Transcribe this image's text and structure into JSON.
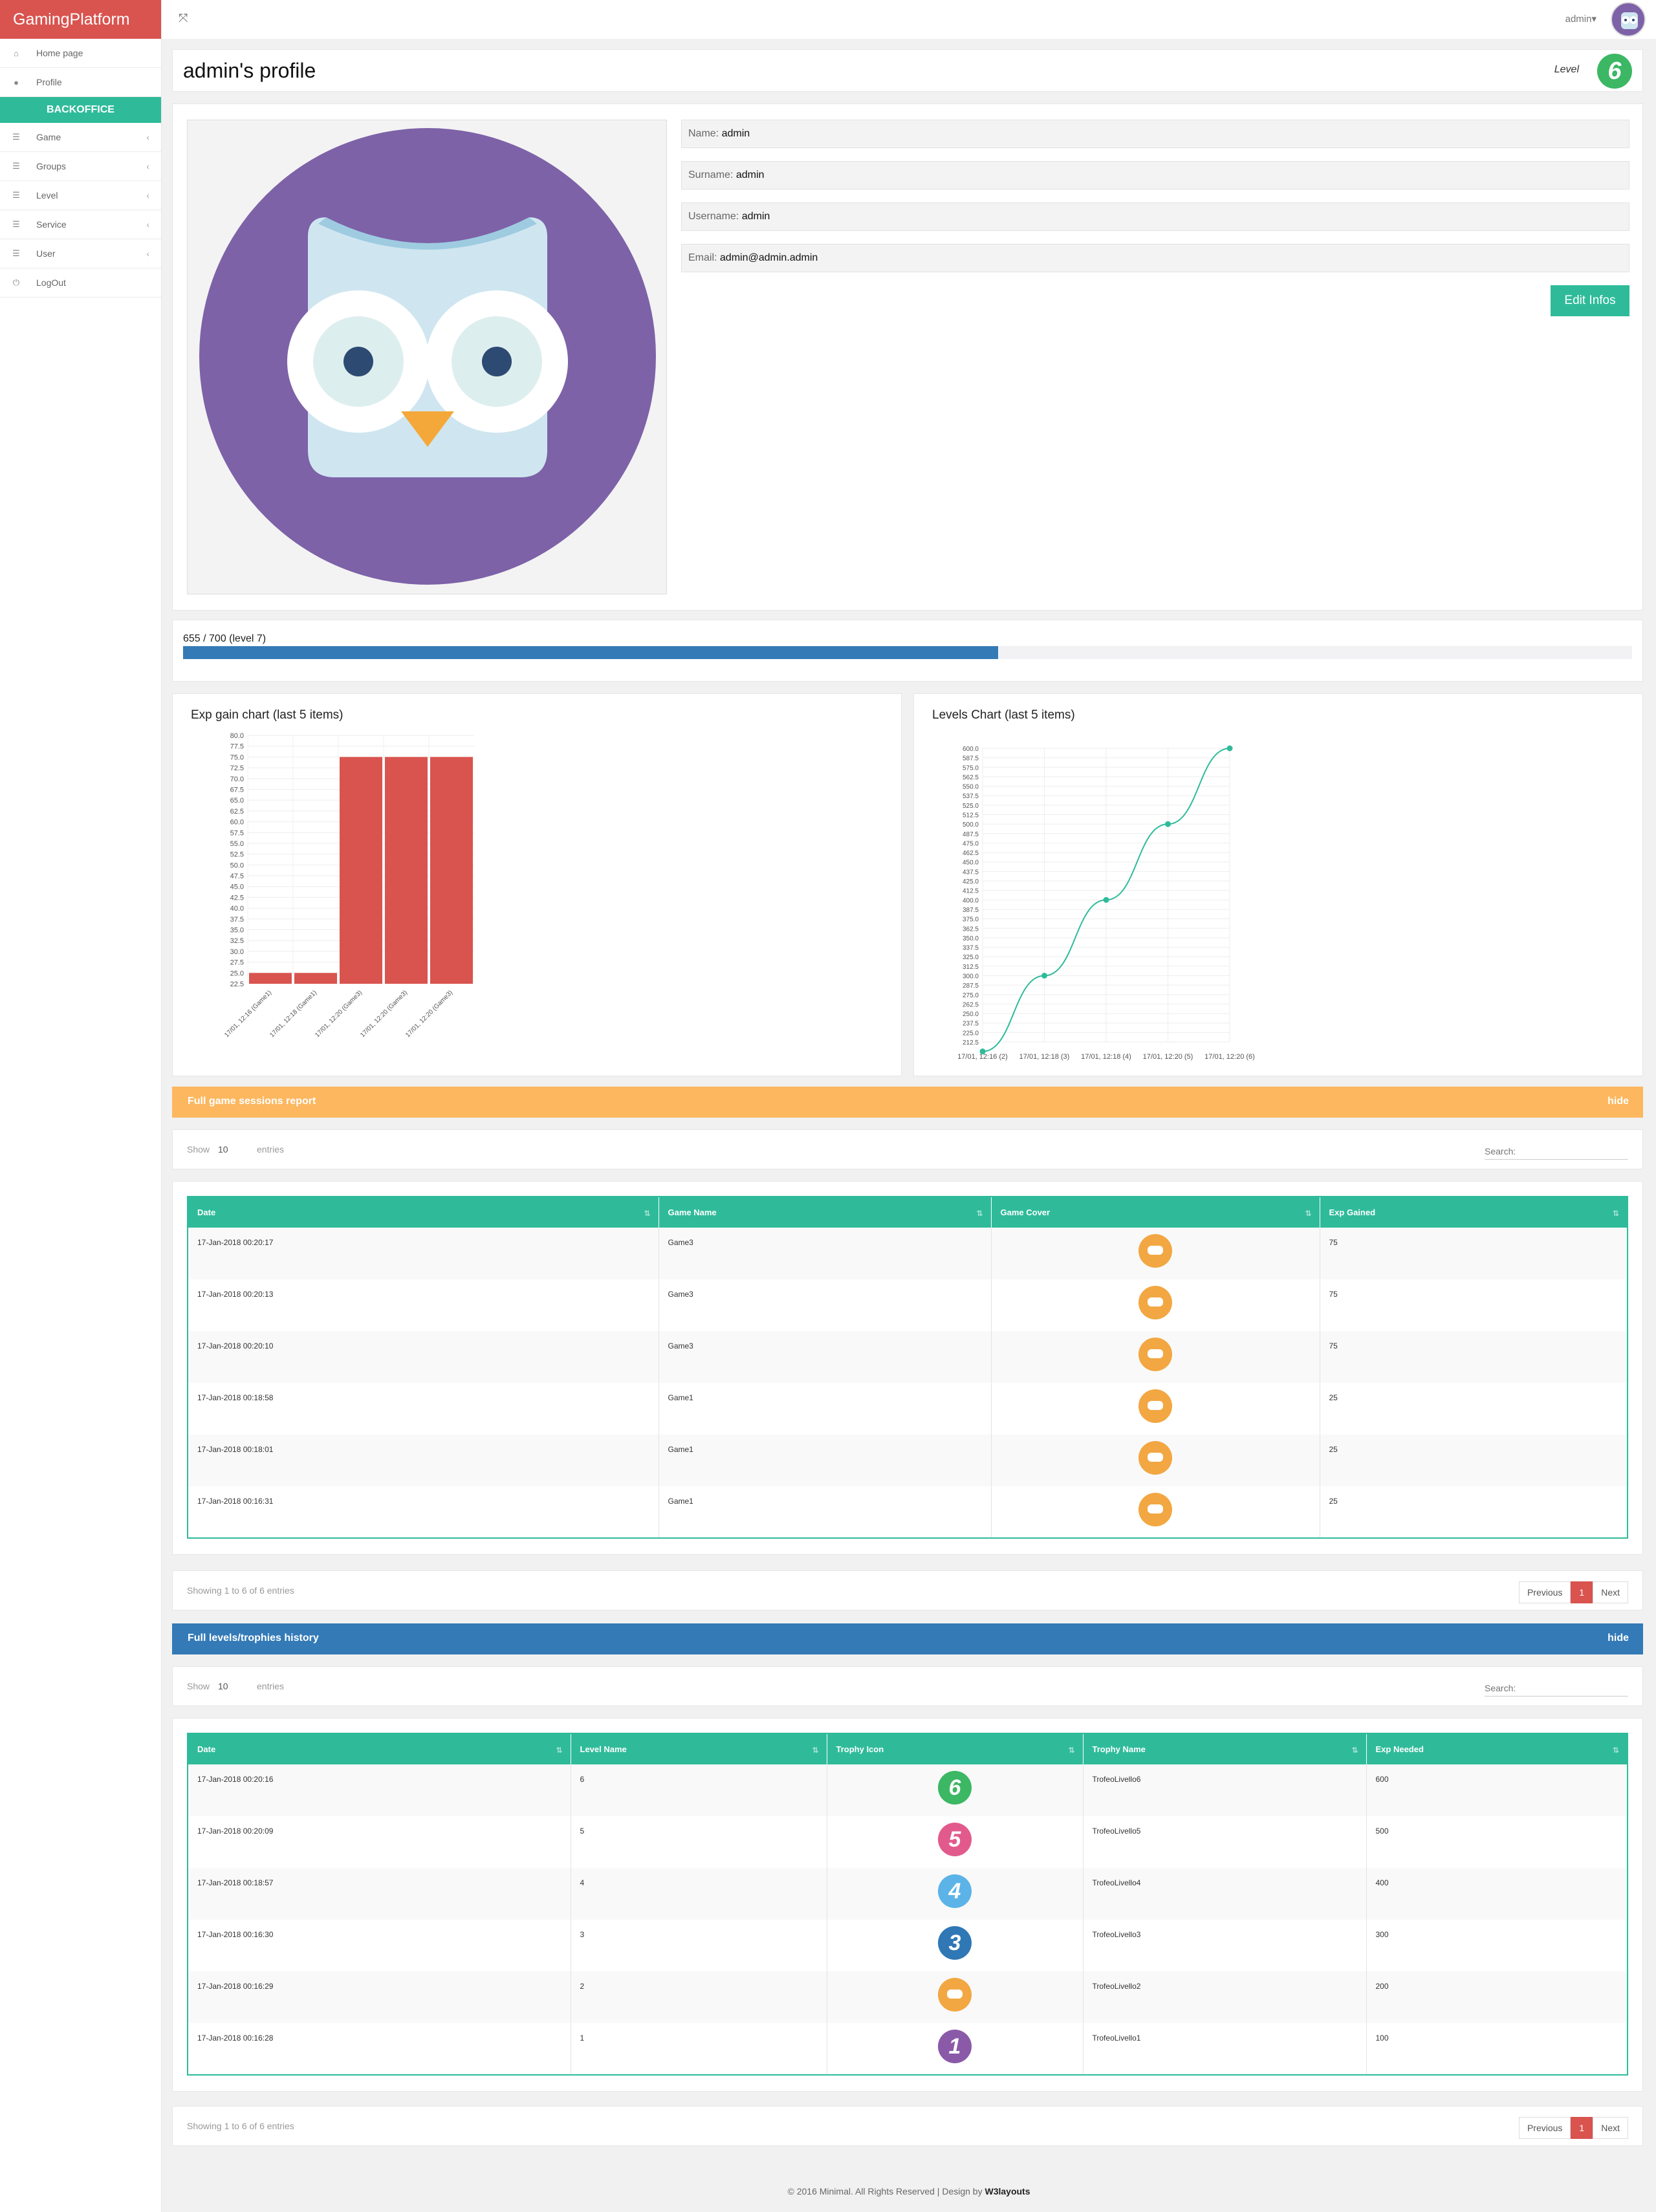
{
  "brand": "GamingPlatform",
  "sidebar": {
    "items": [
      {
        "icon": "home-icon",
        "label": "Home page"
      },
      {
        "icon": "user-icon",
        "label": "Profile"
      }
    ],
    "section": "BACKOFFICE",
    "menus": [
      {
        "label": "Game"
      },
      {
        "label": "Groups"
      },
      {
        "label": "Level"
      },
      {
        "label": "Service"
      },
      {
        "label": "User"
      }
    ],
    "logout": "LogOut"
  },
  "topbar": {
    "user": "admin▾"
  },
  "profile": {
    "title": "admin's profile",
    "level_label": "Level",
    "level_value": "6",
    "fields": [
      {
        "label": "Name:",
        "value": "admin"
      },
      {
        "label": "Surname:",
        "value": "admin"
      },
      {
        "label": "Username:",
        "value": "admin"
      },
      {
        "label": "Email:",
        "value": "admin@admin.admin"
      }
    ],
    "edit_button": "Edit Infos"
  },
  "progress": {
    "label": "655 / 700 (level 7)",
    "fraction": 0.5625
  },
  "chart_data": [
    {
      "type": "bar",
      "title": "Exp gain chart (last 5 items)",
      "categories": [
        "17/01, 12:16 (Game1)",
        "17/01, 12:18 (Game1)",
        "17/01, 12:20 (Game3)",
        "17/01, 12:20 (Game3)",
        "17/01, 12:20 (Game3)"
      ],
      "values": [
        25,
        25,
        75,
        75,
        75
      ],
      "ylim": [
        22.5,
        80
      ],
      "color": "#d9534f"
    },
    {
      "type": "line",
      "title": "Levels Chart (last 5 items)",
      "categories": [
        "17/01, 12:16 (2)",
        "17/01, 12:18 (3)",
        "17/01, 12:18 (4)",
        "17/01, 12:20 (5)",
        "17/01, 12:20 (6)"
      ],
      "values": [
        200,
        300,
        400,
        500,
        600
      ],
      "ylim": [
        212.5,
        600
      ],
      "color": "#2fbb9a"
    }
  ],
  "sessions": {
    "header": "Full game sessions report",
    "hide": "hide",
    "color": "#fcb75f",
    "show": "Show",
    "length": "10",
    "entries": "entries",
    "search_placeholder": "Search:",
    "columns": [
      "Date",
      "Game Name",
      "Game Cover",
      "Exp Gained"
    ],
    "rows": [
      {
        "date": "17-Jan-2018 00:20:17",
        "game": "Game3",
        "cover": "gamepad-icon",
        "exp": "75"
      },
      {
        "date": "17-Jan-2018 00:20:13",
        "game": "Game3",
        "cover": "gamepad-icon",
        "exp": "75"
      },
      {
        "date": "17-Jan-2018 00:20:10",
        "game": "Game3",
        "cover": "gamepad-icon",
        "exp": "75"
      },
      {
        "date": "17-Jan-2018 00:18:58",
        "game": "Game1",
        "cover": "gamepad-icon",
        "exp": "25"
      },
      {
        "date": "17-Jan-2018 00:18:01",
        "game": "Game1",
        "cover": "gamepad-icon",
        "exp": "25"
      },
      {
        "date": "17-Jan-2018 00:16:31",
        "game": "Game1",
        "cover": "gamepad-icon",
        "exp": "25"
      }
    ],
    "info": "Showing 1 to 6 of 6 entries",
    "prev": "Previous",
    "page": "1",
    "next": "Next"
  },
  "trophies": {
    "header": "Full levels/trophies history",
    "hide": "hide",
    "color": "#337ab7",
    "show": "Show",
    "length": "10",
    "entries": "entries",
    "search_placeholder": "Search:",
    "columns": [
      "Date",
      "Level Name",
      "Trophy Icon",
      "Trophy Name",
      "Exp Needed"
    ],
    "rows": [
      {
        "date": "17-Jan-2018 00:20:16",
        "level": "6",
        "icon": "6",
        "icon_color": "#3cb764",
        "name": "TrofeoLivello6",
        "exp": "600"
      },
      {
        "date": "17-Jan-2018 00:20:09",
        "level": "5",
        "icon": "5",
        "icon_color": "#e25a8c",
        "name": "TrofeoLivello5",
        "exp": "500"
      },
      {
        "date": "17-Jan-2018 00:18:57",
        "level": "4",
        "icon": "4",
        "icon_color": "#5bb3e8",
        "name": "TrofeoLivello4",
        "exp": "400"
      },
      {
        "date": "17-Jan-2018 00:16:30",
        "level": "3",
        "icon": "3",
        "icon_color": "#2f77b5",
        "name": "TrofeoLivello3",
        "exp": "300"
      },
      {
        "date": "17-Jan-2018 00:16:29",
        "level": "2",
        "icon": "gamepad-icon",
        "icon_color": "#f2a742",
        "name": "TrofeoLivello2",
        "exp": "200"
      },
      {
        "date": "17-Jan-2018 00:16:28",
        "level": "1",
        "icon": "1",
        "icon_color": "#8a5aa8",
        "name": "TrofeoLivello1",
        "exp": "100"
      }
    ],
    "info": "Showing 1 to 6 of 6 entries",
    "prev": "Previous",
    "page": "1",
    "next": "Next"
  },
  "footer": {
    "text": "© 2016 Minimal. All Rights Reserved | Design by ",
    "credit": "W3layouts"
  }
}
